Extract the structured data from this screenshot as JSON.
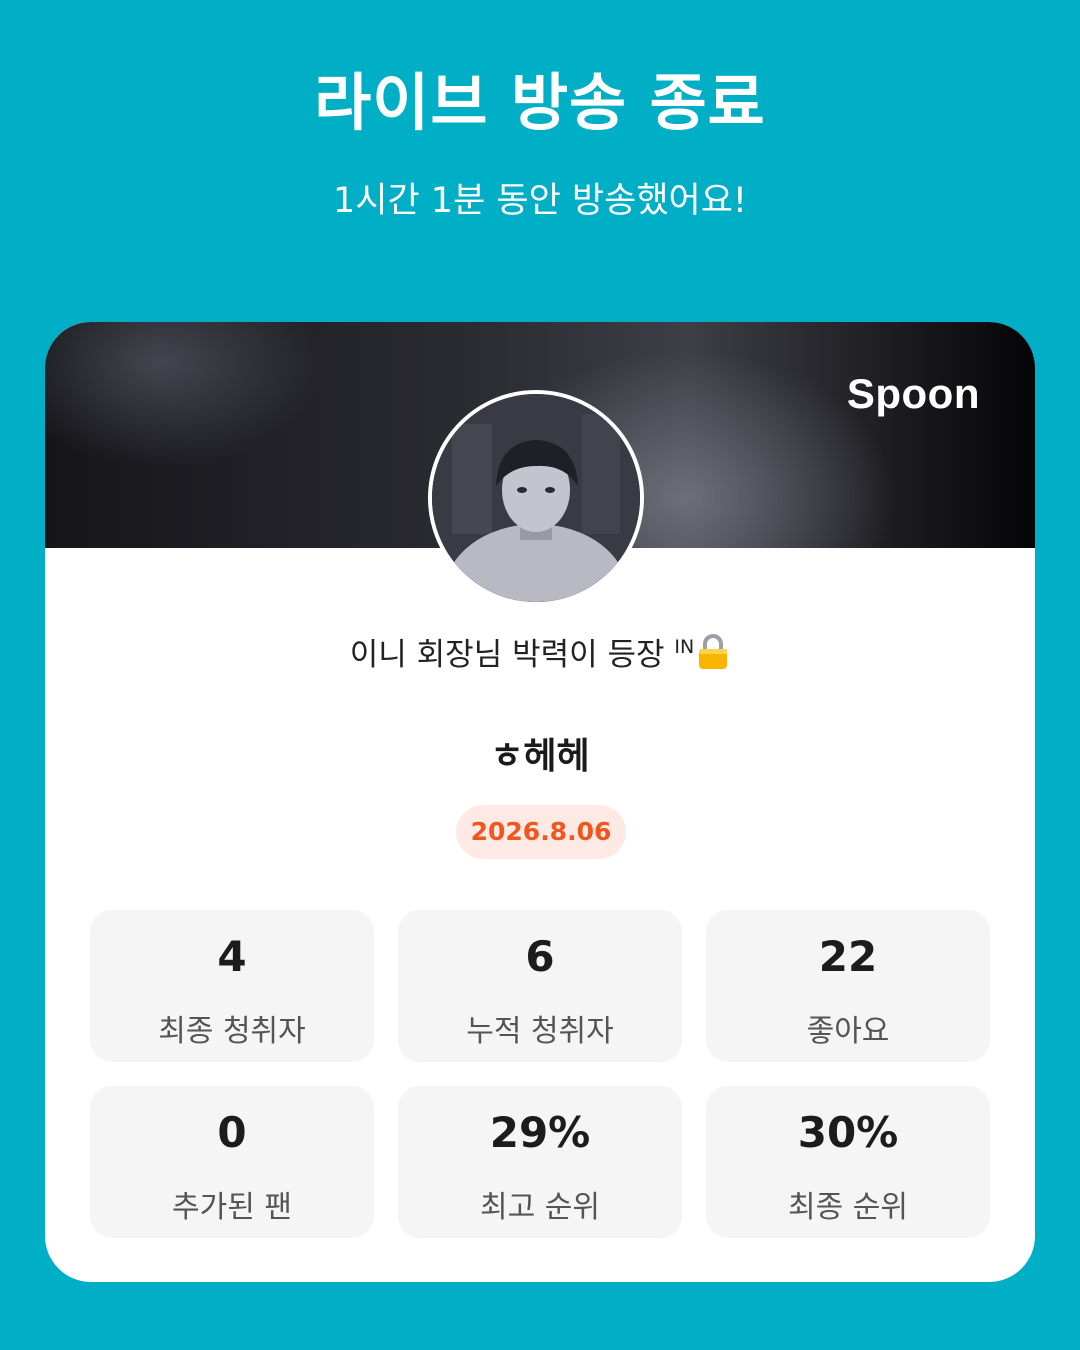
{
  "header": {
    "title": "라이브 방송 종료",
    "subtitle": "1시간 1분 동안 방송했어요!"
  },
  "card": {
    "logo": "Spoon",
    "room_title": "이니 회장님 박력이 등장",
    "room_title_badge": "IN",
    "nickname": "ㅎ헤헤",
    "date": "2026.8.06",
    "stats": [
      {
        "value": "4",
        "label": "최종 청취자"
      },
      {
        "value": "6",
        "label": "누적 청취자"
      },
      {
        "value": "22",
        "label": "좋아요"
      },
      {
        "value": "0",
        "label": "추가된 팬"
      },
      {
        "value": "29%",
        "label": "최고 순위"
      },
      {
        "value": "30%",
        "label": "최종 순위"
      }
    ]
  },
  "colors": {
    "background": "#00AEC6",
    "date_text": "#F2551E",
    "date_pill": "#FDEAE4"
  },
  "icons": {
    "room_title_icon": "lock-icon"
  }
}
